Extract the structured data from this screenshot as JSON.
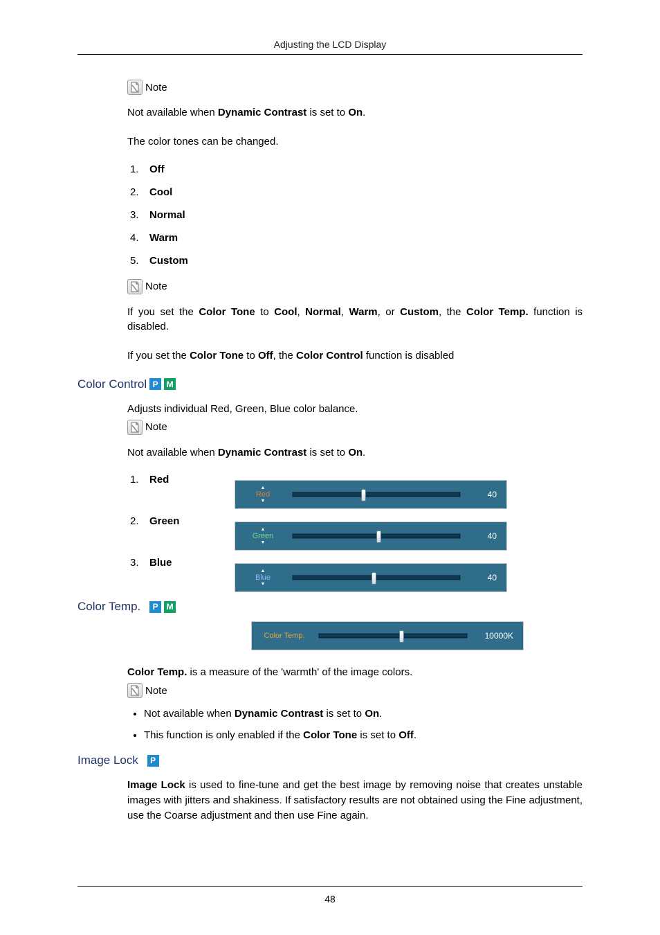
{
  "header": {
    "title": "Adjusting the LCD Display"
  },
  "page_number": "48",
  "notes": {
    "label": "Note",
    "n1_text_pre": "Not available when ",
    "n1_text_bold1": "Dynamic Contrast",
    "n1_text_mid": " is set to ",
    "n1_text_bold2": "On",
    "n1_text_post": "."
  },
  "color_tone": {
    "intro": "The color tones can be changed.",
    "items": [
      "Off",
      "Cool",
      "Normal",
      "Warm",
      "Custom"
    ],
    "para2_pre": "If you set the ",
    "para2_b1": "Color Tone",
    "para2_mid1": " to ",
    "para2_b2": "Cool",
    "para2_c": ", ",
    "para2_b3": "Normal",
    "para2_b4": "Warm",
    "para2_or": ", or ",
    "para2_b5": "Custom",
    "para2_mid2": ", the ",
    "para2_b6": "Color Temp.",
    "para2_post": " function is disabled.",
    "para3_pre": "If you set the ",
    "para3_b1": "Color Tone",
    "para3_mid1": " to ",
    "para3_b2": "Off",
    "para3_mid2": ", the ",
    "para3_b3": "Color Control",
    "para3_post": " function is disabled"
  },
  "color_control": {
    "heading": "Color Control",
    "desc": "Adjusts individual Red, Green, Blue color balance.",
    "sliders": [
      {
        "label": "Red",
        "osd_label": "Red",
        "value": "40",
        "pos": 41
      },
      {
        "label": "Green",
        "osd_label": "Green",
        "value": "40",
        "pos": 50
      },
      {
        "label": "Blue",
        "osd_label": "Blue",
        "value": "40",
        "pos": 47
      }
    ]
  },
  "color_temp": {
    "heading": "Color Temp.",
    "osd_label": "Color Temp.",
    "value": "10000K",
    "pos": 54,
    "desc_b": "Color Temp.",
    "desc_rest": " is a measure of the 'warmth' of the image colors.",
    "bullet1_pre": "Not available when ",
    "bullet1_b1": "Dynamic Contrast",
    "bullet1_mid": " is set to ",
    "bullet1_b2": "On",
    "bullet1_post": ".",
    "bullet2_pre": "This function is only enabled if the ",
    "bullet2_b1": "Color Tone",
    "bullet2_mid": " is set to ",
    "bullet2_b2": "Off",
    "bullet2_post": "."
  },
  "image_lock": {
    "heading": "Image Lock",
    "b": "Image Lock",
    "rest": " is used to fine-tune and get the best image by removing noise that creates unstable images with jitters and shakiness. If satisfactory results are not obtained using the Fine adjustment, use the Coarse adjustment and then use Fine again."
  },
  "badges": {
    "p": "P",
    "m": "M"
  }
}
